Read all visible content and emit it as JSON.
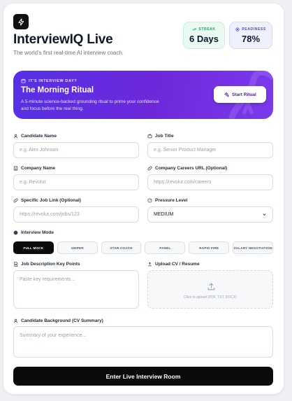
{
  "header": {
    "title": "InterviewIQ Live",
    "subtitle": "The world's first real-time AI interview coach."
  },
  "stats": {
    "streak": {
      "label": "STREAK",
      "value": "6 Days"
    },
    "readiness": {
      "label": "READINESS",
      "value": "78%"
    }
  },
  "banner": {
    "eyebrow": "IT'S INTERVIEW DAY?",
    "title": "The Morning Ritual",
    "description": "A 5-minute science-backed grounding ritual to prime your confidence and focus before the real thing.",
    "button_label": "Start Ritual"
  },
  "form": {
    "candidate_name": {
      "label": "Candidate Name",
      "placeholder": "e.g. Alex Johnson"
    },
    "job_title": {
      "label": "Job Title",
      "placeholder": "e.g. Senior Product Manager"
    },
    "company_name": {
      "label": "Company Name",
      "placeholder": "e.g. Revolut"
    },
    "careers_url": {
      "label": "Company Careers URL (Optional)",
      "placeholder": "https://revolut.com/careers"
    },
    "job_link": {
      "label": "Specific Job Link (Optional)",
      "placeholder": "https://revolut.com/jobs/123"
    },
    "pressure": {
      "label": "Pressure Level",
      "value": "MEDIUM"
    },
    "interview_mode": {
      "label": "Interview Mode",
      "options": [
        "FULL MOCK",
        "SNIPER",
        "STAR COACH",
        "PANEL",
        "RAPID FIRE",
        "SALARY NEGOTIATION"
      ],
      "selected": "FULL MOCK"
    },
    "job_description": {
      "label": "Job Description Key Points",
      "placeholder": "Paste key requirements..."
    },
    "upload_cv": {
      "label": "Upload CV / Resume",
      "hint": "Click to upload (PDF, TXT, DOCX)"
    },
    "background": {
      "label": "Candidate Background (CV Summary)",
      "placeholder": "Summary of your experience..."
    }
  },
  "cta_label": "Enter Live Interview Room",
  "colors": {
    "accent": "#6d28d9",
    "primary_button": "#0b0b0b",
    "streak": "#15a36a",
    "readiness": "#4f46e5"
  }
}
